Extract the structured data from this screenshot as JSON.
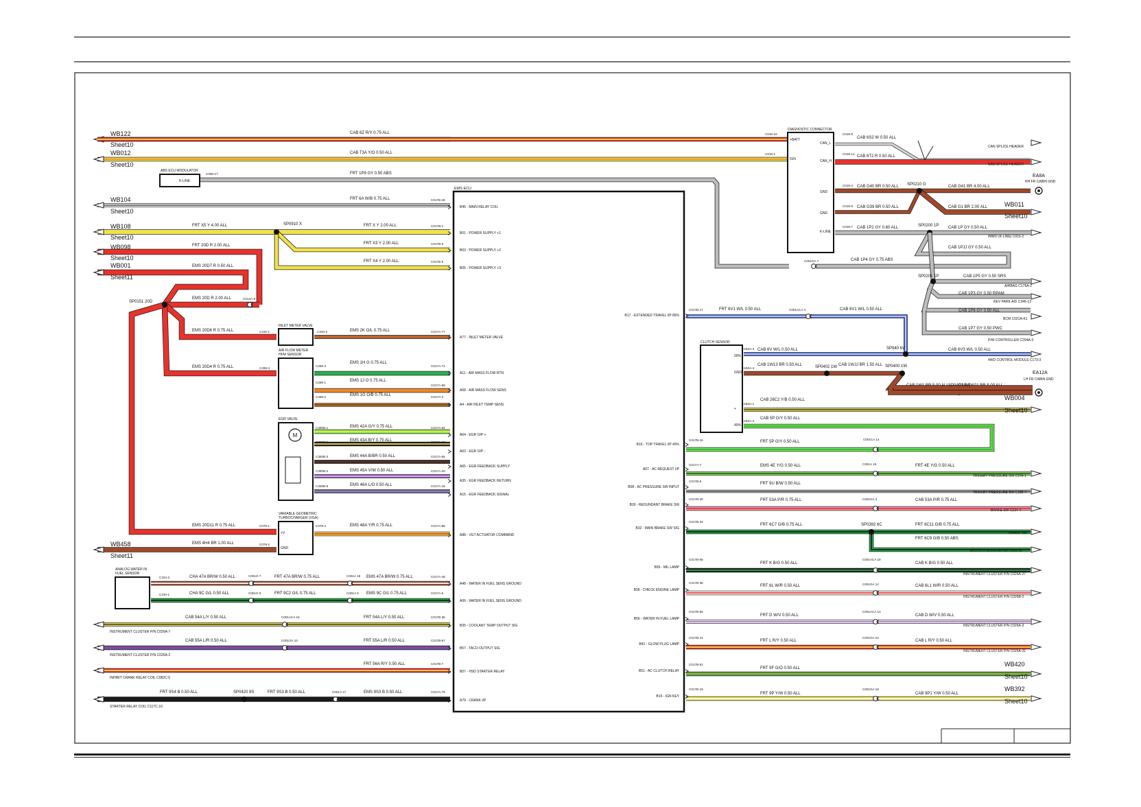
{
  "diagram": {
    "ecu_title": "EMS ECU",
    "diag_title": "DIAGNOSTIC CONNECTOR",
    "diag_pins": [
      "+BATT",
      "IGN",
      "CAN_L",
      "CAN_H",
      "GND",
      "GND",
      "K-LINE"
    ],
    "abs_title": "ABS ECU MODULATOR",
    "abs_pin": "K-LINE",
    "clutch_title": "CLUTCH SENSOR",
    "clutch_pins": [
      "90%",
      "GND",
      "+",
      "40%"
    ],
    "inlet_title": "INLET METER VALVE",
    "afm_title": "AIR FLOW METER\nHFM SENSOR",
    "egr_title": "EGR VALVE",
    "vgt_title": "VARIABLE GEOMETRIC\nTURBOCHARGER (VGA)",
    "vgt_pins": [
      "+V",
      "GND"
    ],
    "water_title": "ANALOG WATER IN\nFUEL SENSOR",
    "left_refs": [
      {
        "name": "WB122",
        "sheet": "Sheet10"
      },
      {
        "name": "WB012",
        "sheet": "Sheet10"
      },
      {
        "name": "WB104",
        "sheet": "Sheet10"
      },
      {
        "name": "WB108",
        "sheet": "Sheet10"
      },
      {
        "name": "WB098",
        "sheet": "Sheet10"
      },
      {
        "name": "WB001",
        "sheet": "Sheet11"
      },
      {
        "name": "WB458",
        "sheet": "Sheet11"
      }
    ],
    "right_refs": [
      {
        "name": "WB011",
        "sheet": "Sheet10"
      },
      {
        "name": "WB004",
        "sheet": "Sheet10"
      },
      {
        "name": "WB420",
        "sheet": "Sheet10"
      },
      {
        "name": "WB392",
        "sheet": "Sheet10"
      }
    ],
    "grounds": [
      {
        "name": "EA8A",
        "desc": "RH FR CABIN GND"
      },
      {
        "name": "EA12A",
        "desc": "LH FR CABIN GND"
      }
    ],
    "splices": [
      "SP0910 X",
      "SP0151 20D",
      "SP0210 G",
      "SP0200 1P",
      "SP0201 1P",
      "SP940 6V",
      "SP0402 1W",
      "SP0400 1W",
      "SP0404 1W",
      "SP0392 6C",
      "SP0420 9S"
    ],
    "wire_labels": [
      "CAB  6Z R/Y 0.75 ALL",
      "CAB  T3A Y/O 0.50 ALL",
      "FRT  1P9 GY 0.50 ABS",
      "FRT  6A W/B 0.75 ALL",
      "FRT  X5 Y 4.00 ALL",
      "FRT  X Y 2.00 ALL",
      "FRT  X3 Y 2.00 ALL",
      "FRT  X4 Y 2.00 ALL",
      "FRT  20D R 2.00 ALL",
      "EMS  20D7 R 0.50 ALL",
      "EMS  20D R 2.00 ALL",
      "EMS  20D6 R 0.75 ALL",
      "EMS  2K O/L 0.75 ALL",
      "EMS  20D4 R 0.75 ALL",
      "EMS  1H G 0.75 ALL",
      "EMS  1J O 0.75 ALL",
      "EMS  1G O/B 0.75 ALL",
      "EMS  42A G/Y 0.75 ALL",
      "EMS  43A B/Y 0.75 ALL",
      "EMS  44A B/BR 0.50 ALL",
      "EMS  45A V/W 0.50 ALL",
      "EMS  46A L/O 0.50 ALL",
      "EMS  20D11 R 0.75 ALL",
      "EMS  4H4 BR 1.00 ALL",
      "EMS  48A Y/R 0.75 ALL",
      "CHA  47A BR/W 0.50 ALL",
      "FRT  47A BR/W 0.75 ALL",
      "EMS  47A BR/W 0.75 ALL",
      "CHA  9C G/L 0.50 ALL",
      "FRT  9C2 G/L 0.75 ALL",
      "EMS  9C G/L 0.75 ALL",
      "CAB  54A L/Y 0.50 ALL",
      "FRT  54A L/Y 0.50 ALL",
      "CAB  55A L/R 0.50 ALL",
      "FRT  55A L/R 0.50 ALL",
      "FRT  56A R/Y 0.50 ALL",
      "FRT  9S4 B 0.50 ALL",
      "FRT  9S3 B 0.50 ALL",
      "EMS  9S3 B 0.50 ALL",
      "CAB  6S2 W 0.50 ALL",
      "CAB  6T2 R 0.50 ALL",
      "CAB  G40 BR 0.50 ALL",
      "CAB  G41 BR 4.00 ALL",
      "CAB  G39 BR 0.50 ALL",
      "CAB  G1 BR 2.00 ALL",
      "CAB  1P2 GY 0.60 ALL",
      "CAB  1P GY 0.50 ALL",
      "CAB  1PJJ GY 0.50 ALL",
      "CAB  1P4 GY 0.75 ABS",
      "CAB  1P5 GY 0.50 SRS",
      "CAB  1P3 GY 0.50 RPAM",
      "CAB  1P6 GY 0.50 ALL",
      "CAB  1P7 GY 0.50 PWC",
      "FRT  6V1 W/L 0.50 ALL",
      "CAB  6V1 W/L 0.50 ALL",
      "CAB  6V W/L 0.50 ALL",
      "CAB  6V3 W/L 0.50 ALL",
      "CAB  1W13 BR 0.50 ALL",
      "CAB  1WJJ BR 1.50 ALL",
      "CAB  1W1 BR 5.00 ALL",
      "CAB  1W21 BR 5.00 ALL",
      "CAB  26C2 Y/B 0.50 ALL",
      "CAB  5P G/Y 0.50 ALL",
      "FRT  5P G/Y 0.50 ALL",
      "EMS  4E Y/G 0.50 ALL",
      "FRT  4E Y/G 0.50 ALL",
      "FRT  9U B/W 0.50 ALL",
      "FRT  53A P/R 0.75 ALL",
      "CAB  53A P/R 0.75 ALL",
      "FRT  6C7 G/B 0.75 ALL",
      "FRT  6C11 G/B 0.75 ALL",
      "FRT  6C9 G/B 0.50 ABS",
      "FRT  K B/G 0.50 ALL",
      "CAB  K B/G 0.50 ALL",
      "FRT  6L W/R 0.50 ALL",
      "CAB  6L1 W/R 0.50 ALL",
      "FRT  D W/V 0.50 ALL",
      "CAB  D W/V 0.50 ALL",
      "FRT  L R/Y 0.50 ALL",
      "CAB  L R/Y 0.50 ALL",
      "FRT  9F G/O 0.50 ALL",
      "FRT  9P Y/W 0.50 ALL",
      "CAB  9P1 Y/W 0.50 ALL"
    ],
    "ecu_pins_left": [
      "B45 - MAIN RELAY COIL",
      "B01 - POWER SUPPLY +1",
      "B03 - POWER SUPPLY +2",
      "B05 - POWER SUPPLY +3",
      "A77 - INLET METER VALVE",
      "A11 - AIR MASS FLOW RTN",
      "A58 - AIR MASS FLOW SENS",
      "A4 - AIR INLET TEMP SENS",
      "A64 - EGR O/P +",
      "A63 - EGR O/P -",
      "A65 - EGR FEEDBACK SUPPLY",
      "A35 - EGR FEEDBACK RETURN",
      "A15 - EGR FEEDBACK SIGNAL",
      "A88 - VGT ACTUATOR COMMAND",
      "A48 - WATER IN FUEL SENS GROUND",
      "A06 - WATER IN FUEL SENS GROUND",
      "B35 - COOLANT TEMP OUTPUT SIG",
      "B57 - TACO OUTPUT SIG",
      "B07 - HSD STARTER RELAY",
      "A79 - CRANK I/P"
    ],
    "ecu_pins_right": [
      "B17 - EXTENDED TRAVEL I/P 85%",
      "B16 - TOP TRAVEL I/P 40%",
      "A07 - AC REQUEST I/P",
      "B08 - AC PRESSURE SW INPUT",
      "B30 - REDUNDANT BRAKE SW",
      "B32 - MAIN BRAKE SW SIG",
      "B55 - MIL LAMP",
      "B38 - CHECK ENGINE LAMP",
      "B56 - WATER IN FUEL LAMP",
      "B41 - GLOW PLUG LAMP",
      "B51 - AC CLUTCH RELAY",
      "B19 - IGN KEY"
    ],
    "dest_labels": [
      "CAN SPLICE HEADER",
      "CAN SPLICE HEADER",
      "IMMO (K-LINE) C016-2",
      "AIRBAG C176A-2",
      "REV PARK AID C346-13",
      "BCM C021A-K1",
      "P/W CONTROLLER C204A-3",
      "4WD CONTROL MODULE C173-3",
      "TRINARY PRESSURE SW C155-1",
      "TRINARY PRESSURE SW C155-4",
      "BRAKE SW C134-4",
      "BRAKE SW",
      "ABS ECU MODULATOR C006-38",
      "INSTRUMENT CLUSTER P/N C026A-27",
      "INSTRUMENT CLUSTER P/N C026B-2",
      "INSTRUMENT CLUSTER P/N C026A-3",
      "INSTRUMENT CLUSTER P/N C026A-31",
      "INSTRUMENT CLUSTER P/N C026A-7",
      "INSTRUMENT CLUSTER P/N C026A-2",
      "INHIBIT CRANK RELAY COIL C082C-5",
      "STARTER RELAY COIL C117C-10"
    ],
    "connectors": [
      "C018-16",
      "C018-1",
      "C006-17",
      "C017B-46",
      "C017B-1",
      "C017B-3",
      "C017B-5",
      "C014A-8",
      "C310-1",
      "C310-2",
      "C017A-77",
      "C299-4",
      "C299-3",
      "C299-1",
      "C299-2",
      "C017A-71",
      "C017A-58",
      "C017A-4",
      "C300B-1",
      "C300B-2",
      "C300B-3",
      "C300B-4",
      "C300B-5",
      "C017A-64",
      "C017A-63",
      "C017A-65",
      "C017A-20",
      "C017A-15",
      "C079-1",
      "C079-2",
      "C079-4",
      "C017A-88",
      "C234-2",
      "C234-1",
      "C001G 7",
      "C001G 8",
      "C001A 18",
      "C001A 6",
      "C017A-48",
      "C017A-6",
      "C001ACA 16",
      "C017B-35",
      "C001GA 10",
      "C017B-57",
      "C017B-7",
      "C001A 17",
      "C017A-79",
      "C018-8",
      "C018-14",
      "C018-4",
      "C018-5",
      "C018-7",
      "C001GA 7",
      "C017B-17",
      "C001ACA 4",
      "C183A-3",
      "C183A-4",
      "C183A-1",
      "C183A-2",
      "C017B-16",
      "C001CA 14",
      "C017A-7",
      "C001A 19",
      "C017B-8",
      "C017B-30",
      "C001GA 3",
      "C017B-32",
      "C017B-55",
      "C001ACA 19",
      "C017B-38",
      "C001GA 12",
      "C017B-56",
      "C001ACA 13",
      "C017B-41",
      "C001GA 22",
      "C017B-51",
      "C017B-19",
      "C001GA 18"
    ]
  }
}
